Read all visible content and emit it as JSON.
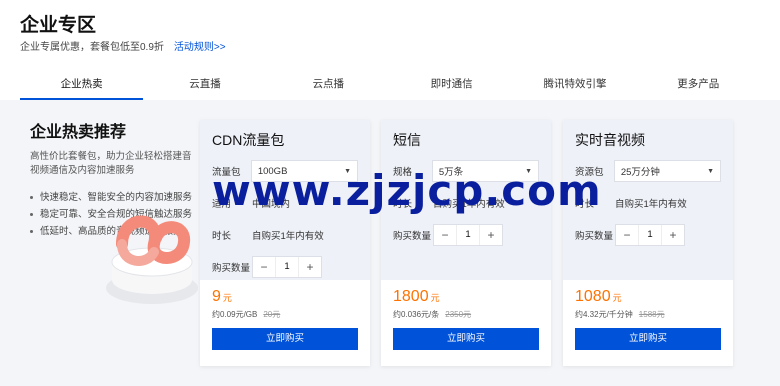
{
  "header": {
    "title": "企业专区",
    "subtitle": "企业专属优惠，套餐包低至0.9折",
    "activity_link": "活动规则>>"
  },
  "tabs": [
    {
      "label": "企业热卖",
      "active": true
    },
    {
      "label": "云直播",
      "active": false
    },
    {
      "label": "云点播",
      "active": false
    },
    {
      "label": "即时通信",
      "active": false
    },
    {
      "label": "腾讯特效引擎",
      "active": false
    },
    {
      "label": "更多产品",
      "active": false
    }
  ],
  "promo": {
    "title": "企业热卖推荐",
    "desc": "高性价比套餐包，助力企业轻松搭建音视频通信及内容加速服务",
    "bullets": [
      "快速稳定、智能安全的内容加速服务",
      "稳定可靠、安全合规的短信触达服务",
      "低延时、高品质的音视频通话服务"
    ]
  },
  "cards": [
    {
      "title": "CDN流量包",
      "spec_label": "流量包",
      "spec_value": "100GB",
      "hidden_label": "适用",
      "hidden_value": "中国境内",
      "duration_label": "时长",
      "duration_value": "自购买1年内有效",
      "qty_label": "购买数量",
      "qty": "1",
      "price": "9",
      "unit": "元",
      "price_sub": "约0.09元/GB",
      "price_orig": "20元",
      "buy_label": "立即购买"
    },
    {
      "title": "短信",
      "spec_label": "规格",
      "spec_value": "5万条",
      "hidden_label": "时长",
      "hidden_value": "自购买1年内有效",
      "qty_label": "购买数量",
      "qty": "1",
      "price": "1800",
      "unit": "元",
      "price_sub": "约0.036元/条",
      "price_orig": "2350元",
      "buy_label": "立即购买"
    },
    {
      "title": "实时音视频",
      "spec_label": "资源包",
      "spec_value": "25万分钟",
      "hidden_label": "时长",
      "hidden_value": "自购买1年内有效",
      "qty_label": "购买数量",
      "qty": "1",
      "price": "1080",
      "unit": "元",
      "price_sub": "约4.32元/千分钟",
      "price_orig": "1588元",
      "buy_label": "立即购买"
    }
  ],
  "watermark": "www.zjzjcp.com",
  "colors": {
    "accent": "#0052d9",
    "price": "#ff7200",
    "watermark": "#0a1f9e"
  }
}
